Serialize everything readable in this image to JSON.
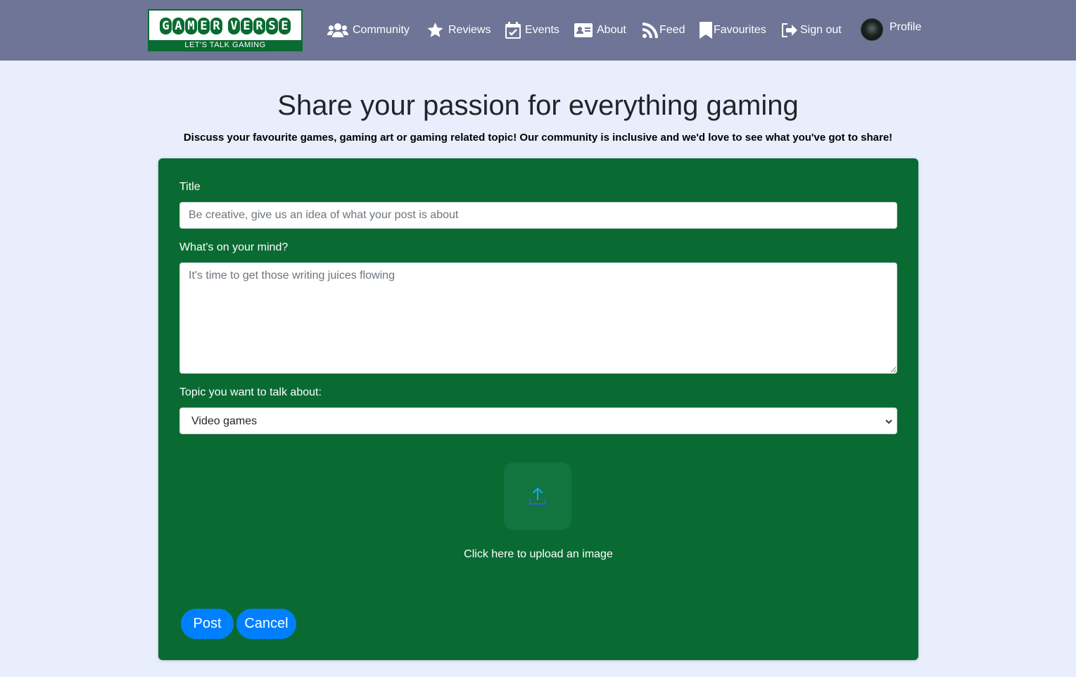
{
  "nav": {
    "logo": {
      "title_word1": "GAMER",
      "title_word2": "VERSE",
      "tagline": "LET'S TALK GAMING"
    },
    "items": [
      {
        "label": "Community",
        "icon": "users-icon"
      },
      {
        "label": "Reviews",
        "icon": "star-icon"
      },
      {
        "label": "Events",
        "icon": "calendar-check-icon"
      },
      {
        "label": "About",
        "icon": "id-card-icon"
      },
      {
        "label": "Feed",
        "icon": "rss-icon"
      },
      {
        "label": "Favourites",
        "icon": "bookmark-icon"
      },
      {
        "label": "Sign out",
        "icon": "sign-out-icon"
      },
      {
        "label": "Profile",
        "icon": "avatar"
      }
    ]
  },
  "page": {
    "title": "Share your passion for everything gaming",
    "subtitle": "Discuss your favourite games, gaming art or gaming related topic! Our community is inclusive and we'd love to see what you've got to share!"
  },
  "form": {
    "title_label": "Title",
    "title_placeholder": "Be creative, give us an idea of what your post is about",
    "title_value": "",
    "content_label": "What's on your mind?",
    "content_placeholder": "It's time to get those writing juices flowing",
    "content_value": "",
    "topic_label": "Topic you want to talk about:",
    "topic_selected": "Video games",
    "upload_text": "Click here to upload an image",
    "post_button": "Post",
    "cancel_button": "Cancel"
  },
  "colors": {
    "navbar_bg": "#6e7596",
    "page_bg": "#e8eefc",
    "card_bg": "#0a6b32",
    "button_bg": "#0080ff",
    "upload_icon": "#17a2ff"
  }
}
